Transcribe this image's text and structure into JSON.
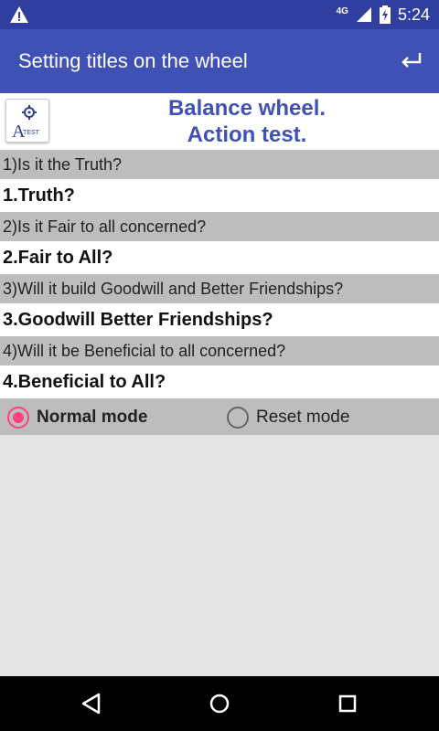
{
  "status_bar": {
    "network": "4G",
    "time": "5:24",
    "icons": [
      "warning-icon",
      "signal-icon",
      "battery-charging-icon"
    ]
  },
  "app_bar": {
    "title": "Setting titles on the wheel",
    "back_icon": "return-arrow-icon"
  },
  "header": {
    "logo_letter": "A",
    "logo_sub": "TEST",
    "title_line1": "Balance wheel.",
    "title_line2": "Action test."
  },
  "items": [
    {
      "question": "1)Is it the Truth?",
      "answer": "1.Truth?"
    },
    {
      "question": "2)Is it Fair to all concerned?",
      "answer": "2.Fair to All?"
    },
    {
      "question": "3)Will it build Goodwill and Better Friendships?",
      "answer": "3.Goodwill Better Friendships?"
    },
    {
      "question": "4)Will it be Beneficial to all concerned?",
      "answer": "4.Beneficial to All?"
    }
  ],
  "modes": {
    "normal_label": "Normal mode",
    "reset_label": "Reset mode",
    "selected": "normal"
  },
  "colors": {
    "primary": "#3f51b5",
    "primary_dark": "#303f9f",
    "accent": "#ff4081",
    "row_gray": "#bdbdbd"
  },
  "nav_bar": {
    "icons": [
      "back-triangle-icon",
      "home-circle-icon",
      "recents-square-icon"
    ]
  }
}
